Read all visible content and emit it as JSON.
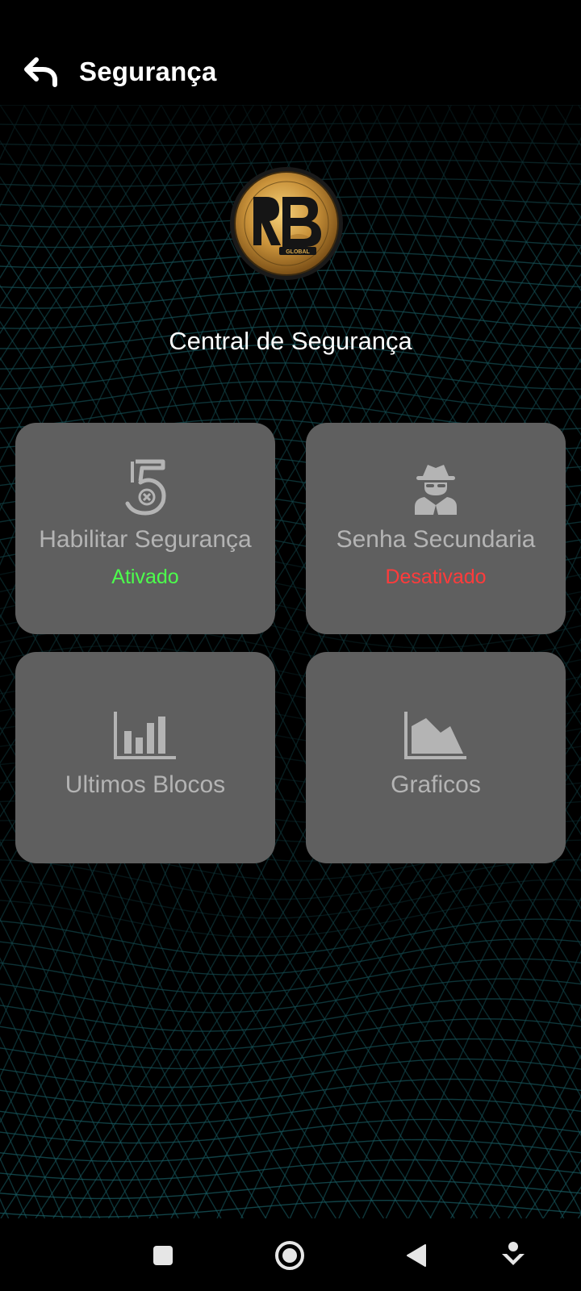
{
  "header": {
    "title": "Segurança",
    "back_icon": "undo-arrow-icon"
  },
  "logo": {
    "name": "rb-global-coin-logo"
  },
  "main": {
    "section_title": "Central de Segurança",
    "tiles": [
      {
        "label": "Habilitar Segurança",
        "status": "Ativado",
        "status_color": "#4cff4c",
        "icon": "security-five-icon"
      },
      {
        "label": "Senha Secundaria",
        "status": "Desativado",
        "status_color": "#ff3b3b",
        "icon": "spy-agent-icon"
      },
      {
        "label": "Ultimos Blocos",
        "icon": "bar-chart-icon"
      },
      {
        "label": "Graficos",
        "icon": "area-chart-icon"
      }
    ]
  },
  "nav_bar": {
    "items": [
      "square-recents-icon",
      "circle-home-icon",
      "triangle-back-icon",
      "assistant-down-icon"
    ]
  },
  "colors": {
    "background": "#000000",
    "tile": "#5f5f5f",
    "tile_text": "#b4b4b4",
    "grid": "#1b6b72"
  }
}
